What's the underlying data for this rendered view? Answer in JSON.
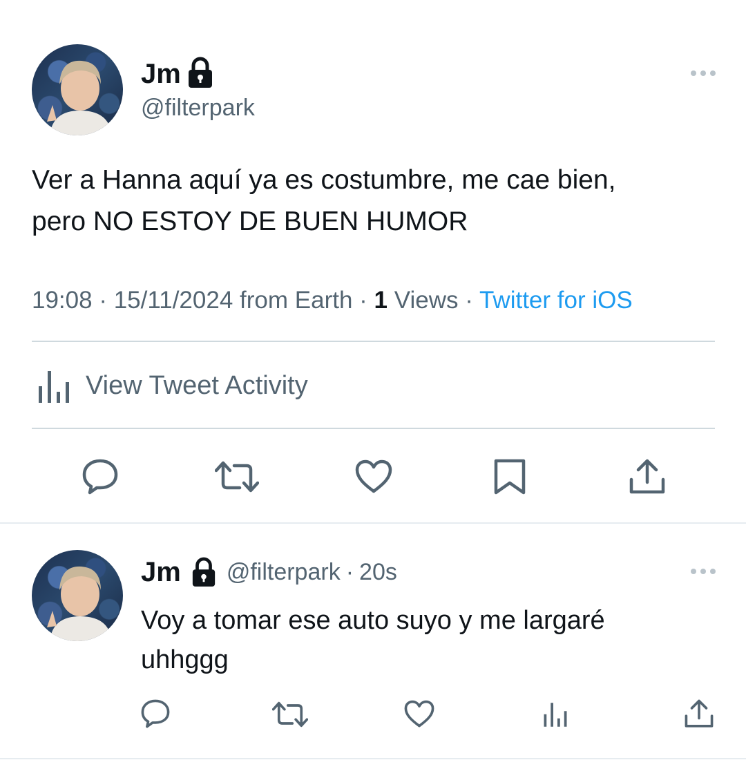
{
  "main_tweet": {
    "author": {
      "name": "Jm",
      "handle": "@filterpark",
      "lock_icon": "lock-icon"
    },
    "text_line1": "Ver a Hanna aquí ya es costumbre, me cae bien,",
    "text_line2": "pero NO ESTOY DE BUEN HUMOR",
    "meta": {
      "time": "19:08",
      "date": "15/11/2024",
      "location": "from Earth",
      "views_count": "1",
      "views_label": "Views",
      "source": "Twitter for iOS",
      "separator": "·"
    },
    "activity_label": "View Tweet Activity",
    "actions": [
      "reply-icon",
      "retweet-icon",
      "like-icon",
      "bookmark-icon",
      "share-icon"
    ]
  },
  "reply_tweet": {
    "author": {
      "name": "Jm",
      "handle": "@filterpark",
      "separator": "·",
      "time": "20s"
    },
    "text_line1": "Voy a tomar ese auto suyo y me largaré",
    "text_line2": "uhhggg",
    "actions": [
      "reply-icon",
      "retweet-icon",
      "like-icon",
      "views-icon",
      "share-icon"
    ]
  },
  "colors": {
    "text_primary": "#0f1419",
    "text_secondary": "#536471",
    "link": "#1d9bf0",
    "divider": "#cfd9de"
  }
}
